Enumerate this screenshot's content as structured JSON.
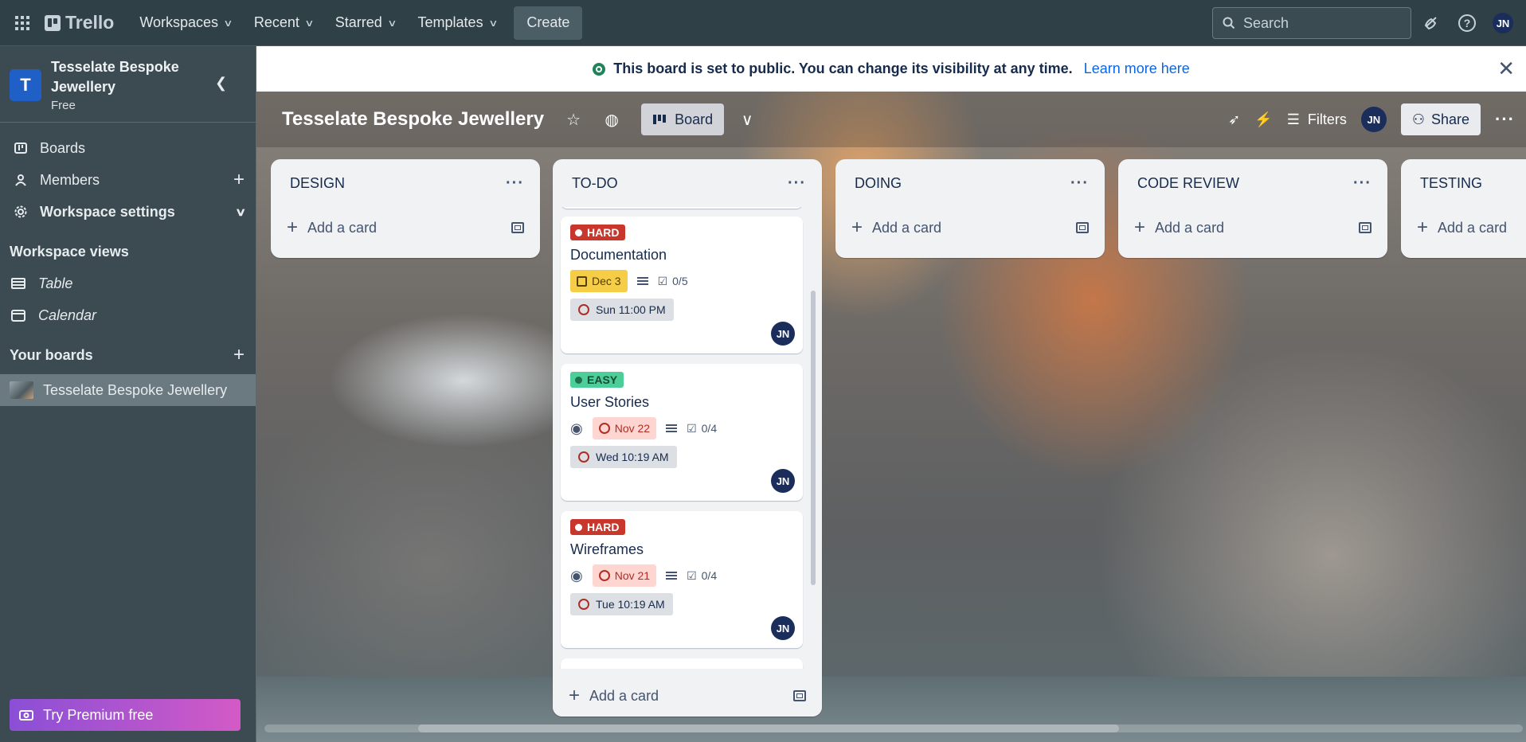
{
  "topnav": {
    "brand": "Trello",
    "menus": [
      "Workspaces",
      "Recent",
      "Starred",
      "Templates"
    ],
    "create": "Create",
    "search_placeholder": "Search",
    "user_initials": "JN"
  },
  "sidebar": {
    "workspace_letter": "T",
    "workspace_name": "Tesselate Bespoke Jewellery",
    "plan": "Free",
    "items": [
      "Boards",
      "Members",
      "Workspace settings"
    ],
    "views_heading": "Workspace views",
    "views": [
      "Table",
      "Calendar"
    ],
    "boards_heading": "Your boards",
    "boards": [
      "Tesselate Bespoke Jewellery"
    ],
    "premium": "Try Premium free"
  },
  "banner": {
    "text": "This board is set to public. You can change its visibility at any time.",
    "link": "Learn more here"
  },
  "board": {
    "title": "Tesselate Bespoke Jewellery",
    "view_label": "Board",
    "filters": "Filters",
    "member_initials": "JN",
    "share": "Share"
  },
  "lists": [
    {
      "title": "DESIGN",
      "add": "Add a card"
    },
    {
      "title": "TO-DO",
      "add": "Add a card"
    },
    {
      "title": "DOING",
      "add": "Add a card"
    },
    {
      "title": "CODE REVIEW",
      "add": "Add a card"
    },
    {
      "title": "TESTING",
      "add": "Add a card"
    }
  ],
  "cards": [
    {
      "label": "HARD",
      "title": "Documentation",
      "due": "Dec 3",
      "checklist": "0/5",
      "reminder": "Sun 11:00 PM",
      "member": "JN"
    },
    {
      "label": "EASY",
      "title": "User Stories",
      "due": "Nov 22",
      "checklist": "0/4",
      "reminder": "Wed 10:19 AM",
      "member": "JN"
    },
    {
      "label": "HARD",
      "title": "Wireframes",
      "due": "Nov 21",
      "checklist": "0/4",
      "reminder": "Tue 10:19 AM",
      "member": "JN"
    }
  ],
  "colors": {
    "hard": "#c9372c",
    "easy": "#4bce97",
    "due_yellow": "#f5cd47",
    "due_red": "#ffd5d2",
    "accent": "#0c66e4"
  }
}
